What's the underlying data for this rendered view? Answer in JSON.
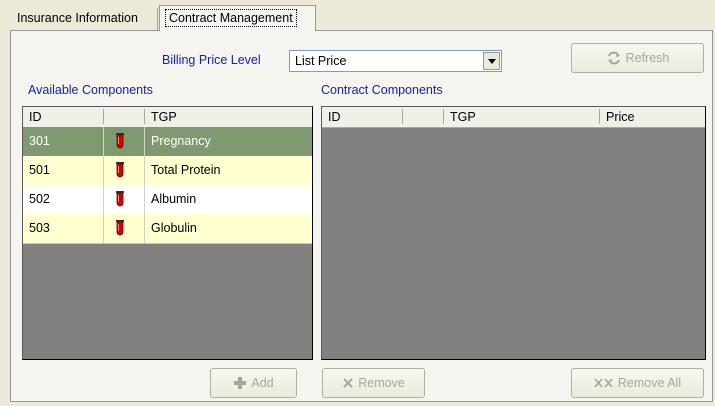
{
  "tabs": [
    {
      "label": "Insurance Information"
    },
    {
      "label": "Contract Management"
    }
  ],
  "billing": {
    "label": "Billing Price Level",
    "value": "List Price"
  },
  "buttons": {
    "refresh": "Refresh",
    "add": "Add",
    "remove": "Remove",
    "remove_all": "Remove All"
  },
  "available": {
    "title": "Available Components",
    "columns": [
      "ID",
      "",
      "TGP"
    ],
    "rows": [
      {
        "id": "301",
        "icon": "test-tube-icon",
        "tgp": "Pregnancy"
      },
      {
        "id": "501",
        "icon": "test-tube-icon",
        "tgp": "Total Protein"
      },
      {
        "id": "502",
        "icon": "test-tube-icon",
        "tgp": "Albumin"
      },
      {
        "id": "503",
        "icon": "test-tube-icon",
        "tgp": "Globulin"
      }
    ]
  },
  "contract": {
    "title": "Contract Components",
    "columns": [
      "ID",
      "",
      "TGP",
      "Price"
    ],
    "rows": []
  },
  "colors": {
    "label_blue": "#15249f",
    "selected_row": "#7f9a70",
    "alt_row": "#ffffd0",
    "empty_grid": "#808080",
    "tube_red": "#d40000"
  }
}
